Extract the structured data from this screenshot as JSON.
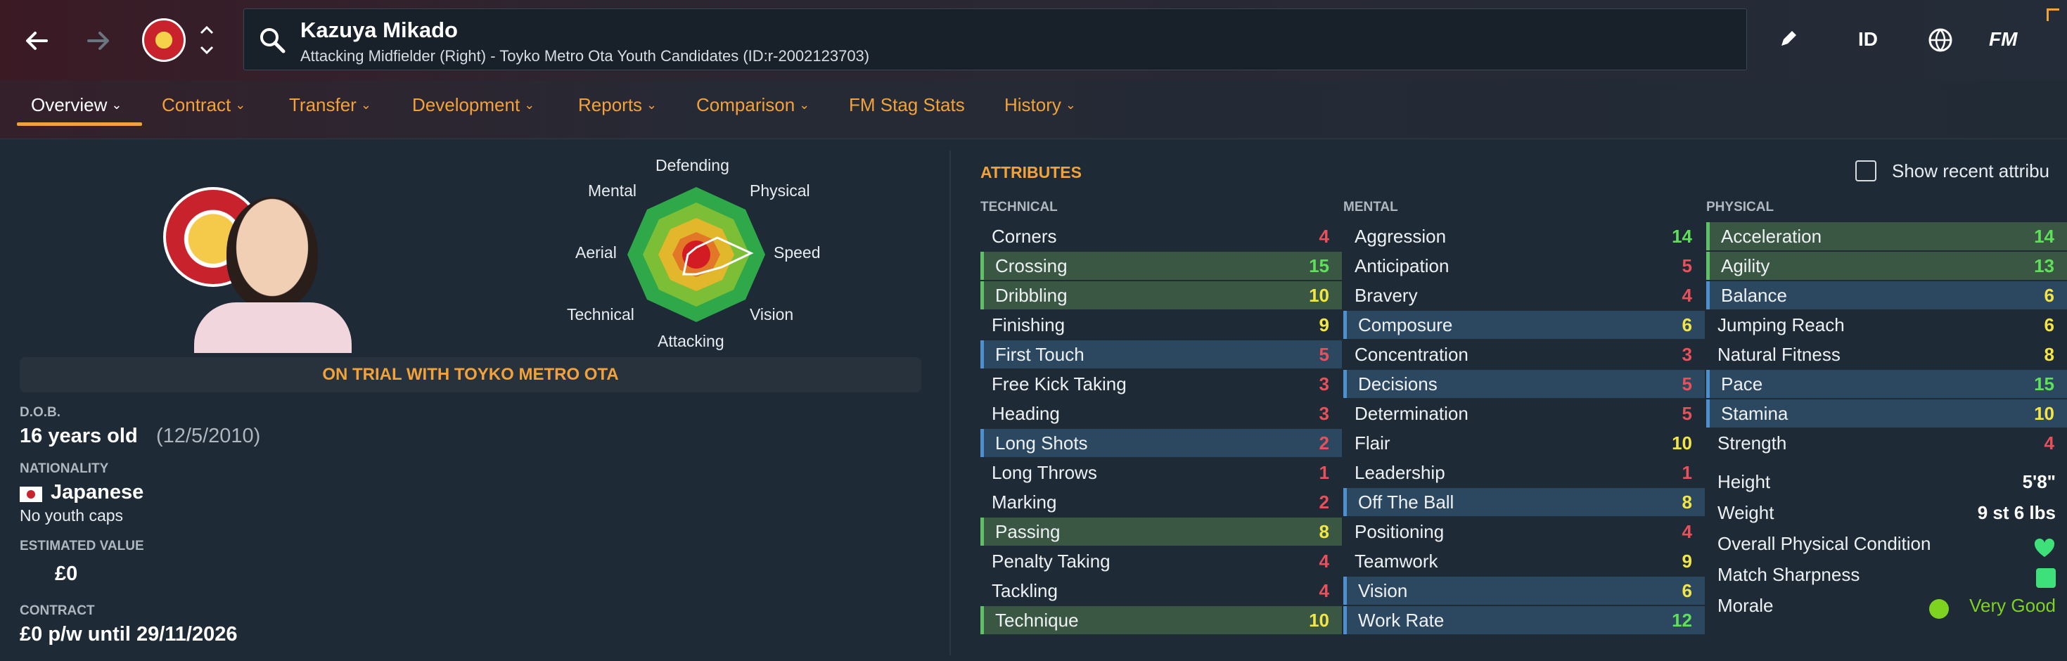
{
  "header": {
    "player_name": "Kazuya Mikado",
    "player_subtitle": "Attacking Midfielder (Right) - Toyko Metro Ota Youth Candidates (ID:r-2002123703)",
    "id_label": "ID",
    "fm_label": "FM"
  },
  "tabs": [
    {
      "label": "Overview"
    },
    {
      "label": "Contract"
    },
    {
      "label": "Transfer"
    },
    {
      "label": "Development"
    },
    {
      "label": "Reports"
    },
    {
      "label": "Comparison"
    },
    {
      "label": "FM Stag Stats"
    },
    {
      "label": "History"
    }
  ],
  "radar": {
    "labels": [
      "Defending",
      "Physical",
      "Speed",
      "Vision",
      "Attacking",
      "Technical",
      "Aerial",
      "Mental"
    ]
  },
  "profile": {
    "trial_banner": "ON TRIAL WITH TOYKO METRO OTA",
    "dob_label": "D.O.B.",
    "age": "16 years old",
    "dob": "(12/5/2010)",
    "nationality_label": "NATIONALITY",
    "nationality": "Japanese",
    "caps": "No youth caps",
    "value_label": "ESTIMATED VALUE",
    "value": "£0",
    "contract_label": "CONTRACT",
    "contract": "£0 p/w until 29/11/2026"
  },
  "attributes": {
    "title": "ATTRIBUTES",
    "show_recent": "Show recent attribu",
    "technical_head": "TECHNICAL",
    "mental_head": "MENTAL",
    "physical_head": "PHYSICAL",
    "technical": [
      {
        "name": "Corners",
        "value": "4"
      },
      {
        "name": "Crossing",
        "value": "15"
      },
      {
        "name": "Dribbling",
        "value": "10"
      },
      {
        "name": "Finishing",
        "value": "9"
      },
      {
        "name": "First Touch",
        "value": "5"
      },
      {
        "name": "Free Kick Taking",
        "value": "3"
      },
      {
        "name": "Heading",
        "value": "3"
      },
      {
        "name": "Long Shots",
        "value": "2"
      },
      {
        "name": "Long Throws",
        "value": "1"
      },
      {
        "name": "Marking",
        "value": "2"
      },
      {
        "name": "Passing",
        "value": "8"
      },
      {
        "name": "Penalty Taking",
        "value": "4"
      },
      {
        "name": "Tackling",
        "value": "4"
      },
      {
        "name": "Technique",
        "value": "10"
      }
    ],
    "mental": [
      {
        "name": "Aggression",
        "value": "14"
      },
      {
        "name": "Anticipation",
        "value": "5"
      },
      {
        "name": "Bravery",
        "value": "4"
      },
      {
        "name": "Composure",
        "value": "6"
      },
      {
        "name": "Concentration",
        "value": "3"
      },
      {
        "name": "Decisions",
        "value": "5"
      },
      {
        "name": "Determination",
        "value": "5"
      },
      {
        "name": "Flair",
        "value": "10"
      },
      {
        "name": "Leadership",
        "value": "1"
      },
      {
        "name": "Off The Ball",
        "value": "8"
      },
      {
        "name": "Positioning",
        "value": "4"
      },
      {
        "name": "Teamwork",
        "value": "9"
      },
      {
        "name": "Vision",
        "value": "6"
      },
      {
        "name": "Work Rate",
        "value": "12"
      }
    ],
    "physical": [
      {
        "name": "Acceleration",
        "value": "14"
      },
      {
        "name": "Agility",
        "value": "13"
      },
      {
        "name": "Balance",
        "value": "6"
      },
      {
        "name": "Jumping Reach",
        "value": "6"
      },
      {
        "name": "Natural Fitness",
        "value": "8"
      },
      {
        "name": "Pace",
        "value": "15"
      },
      {
        "name": "Stamina",
        "value": "10"
      },
      {
        "name": "Strength",
        "value": "4"
      }
    ],
    "other": [
      {
        "name": "Height",
        "value": "5'8\""
      },
      {
        "name": "Weight",
        "value": "9 st 6 lbs"
      },
      {
        "name": "Overall Physical Condition",
        "value": ""
      },
      {
        "name": "Match Sharpness",
        "value": ""
      },
      {
        "name": "Morale",
        "value": "Very Good"
      }
    ]
  },
  "colors": {
    "accent": "#f2a23a",
    "low": "#e8505b",
    "mid": "#f3e545",
    "high": "#5fe05a",
    "highlight_blue": "#2c4860",
    "highlight_green": "#3a5744"
  }
}
